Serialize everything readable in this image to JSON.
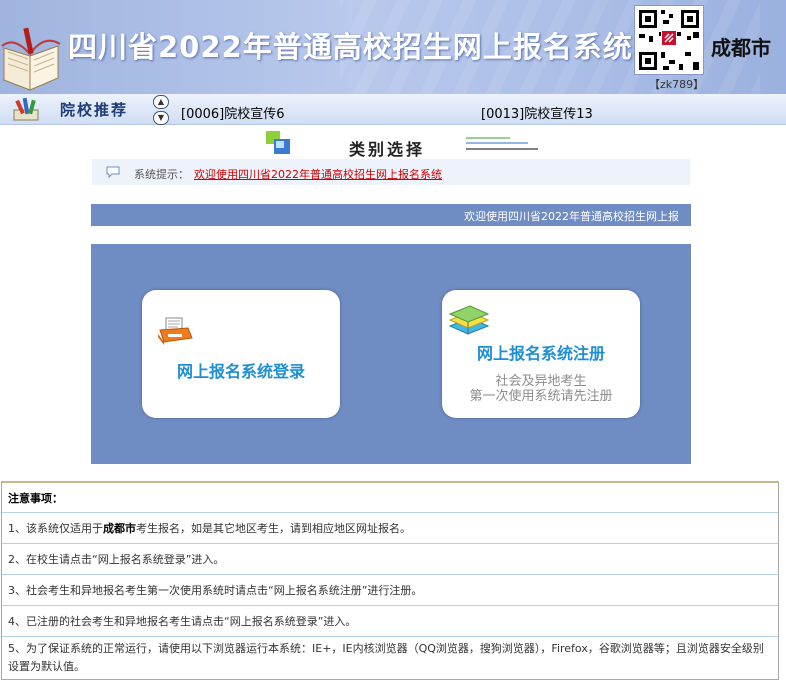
{
  "header": {
    "title": "四川省2022年普通高校招生网上报名系统",
    "city": "成都市",
    "qr_code_label": "【zk789】"
  },
  "recommend": {
    "title": "院校推荐",
    "links": [
      "[0006]院校宣传6",
      "[0013]院校宣传13"
    ]
  },
  "category": {
    "title": "类别选择"
  },
  "notice": {
    "label": "系统提示：",
    "text": "欢迎使用四川省2022年普通高校招生网上报名系统"
  },
  "marquee": {
    "text": "欢迎使用四川省2022年普通高校招生网上报"
  },
  "cards": {
    "login_label": "网上报名系统登录",
    "register_label": "网上报名系统注册",
    "register_sub1": "社会及异地考生",
    "register_sub2": "第一次使用系统请先注册"
  },
  "notes": {
    "heading": "注意事项：",
    "item1_pre": "1、该系统仅适用于",
    "item1_bold": "成都市",
    "item1_post": "考生报名，如是其它地区考生，请到相应地区网址报名。",
    "item2": "2、在校生请点击“网上报名系统登录”进入。",
    "item3": "3、社会考生和异地报名考生第一次使用系统时请点击“网上报名系统注册”进行注册。",
    "item4": "4、已注册的社会考生和异地报名考生请点击“网上报名系统登录”进入。",
    "item5": "5、为了保证系统的正常运行，请使用以下浏览器运行本系统：IE+，IE内核浏览器（QQ浏览器，搜狗浏览器），Firefox，谷歌浏览器等；且浏览器安全级别设置为默认值。"
  },
  "colors": {
    "banner": "#a9bde6",
    "panel": "#6f8cc3",
    "card_label": "#1f8fd4",
    "notice_text": "#d00000"
  },
  "icons": {
    "banner": "book-icon",
    "recommend": "pen-icon",
    "category": "squares-icon",
    "notice": "speech-bubble-icon",
    "login": "printer-icon",
    "register": "books-icon"
  }
}
